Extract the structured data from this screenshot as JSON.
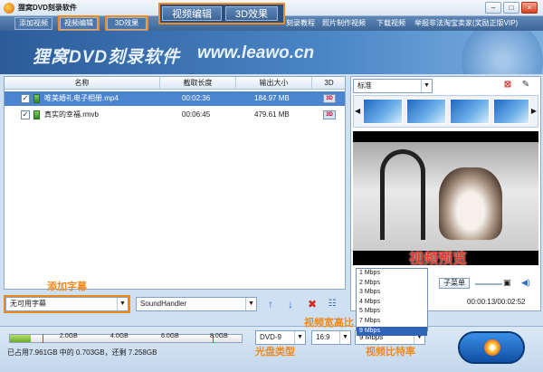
{
  "window": {
    "title": "狸窝DVD刻录软件",
    "min": "–",
    "max": "□",
    "close": "×"
  },
  "menu": {
    "add_video": "添加视频",
    "edit_video": "视频编辑",
    "effect_3d": "3D效果",
    "right_items": [
      "刻录教程",
      "照片制作视频",
      "下载视频",
      "举报非法淘宝卖家(奖励正版VIP)"
    ]
  },
  "callout_tabs": [
    "视频编辑",
    "3D效果"
  ],
  "banner": {
    "title": "狸窝DVD刻录软件",
    "url": "www.leawo.cn"
  },
  "file_list": {
    "columns": [
      "名称",
      "截取长度",
      "输出大小",
      "3D"
    ],
    "rows": [
      {
        "name": "唯美婚礼电子相册.mp4",
        "length": "00:02:36",
        "size": "184.97 MB",
        "selected": true
      },
      {
        "name": "真实的幸福.rmvb",
        "length": "00:06:45",
        "size": "479.61 MB",
        "selected": false
      }
    ]
  },
  "subtitle_combo": "无可用字幕",
  "audio_combo": "SoundHandler",
  "preview": {
    "preset": "标准",
    "time": "00:00:13/00:02:52",
    "menu_button": "子菜单",
    "label": "视频预览"
  },
  "bitrate_options": [
    "1 Mbps",
    "2 Mbps",
    "3 Mbps",
    "4 Mbps",
    "5 Mbps",
    "7 Mbps",
    "9 Mbps"
  ],
  "bitrate_selected": "9 Mbps",
  "disc_type": "DVD-9",
  "aspect": "16:9",
  "capacity": {
    "ticks": [
      "2.0GB",
      "4.0GB",
      "6.0GB",
      "8.0GB"
    ],
    "used_fraction": 0.09,
    "info": "已占用7.961GB 中的 0.703GB，还剩 7.258GB"
  },
  "annotations": {
    "add_subtitle": "添加字幕",
    "disc_type": "光盘类型",
    "aspect": "视频宽高比",
    "bitrate": "视频比特率"
  }
}
